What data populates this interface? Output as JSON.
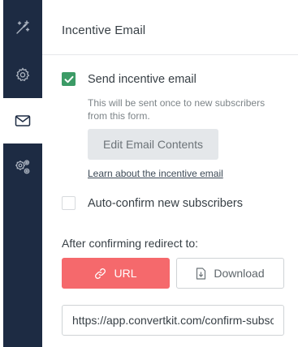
{
  "sidebar": {
    "items": [
      {
        "icon": "magic-wand-icon",
        "active": false
      },
      {
        "icon": "gear-icon",
        "active": false
      },
      {
        "icon": "envelope-icon",
        "active": true
      },
      {
        "icon": "gears-icon",
        "active": false
      }
    ],
    "rail_color": "#1d2b43"
  },
  "header": {
    "title": "Incentive Email"
  },
  "incentive": {
    "send_label": "Send incentive email",
    "send_checked": true,
    "help_text": "This will be sent once to new subscribers from this form.",
    "edit_button_label": "Edit Email Contents",
    "learn_link_label": "Learn about the incentive email"
  },
  "auto_confirm": {
    "label": "Auto-confirm new subscribers",
    "checked": false
  },
  "redirect": {
    "label": "After confirming redirect to:",
    "url_button_label": "URL",
    "download_button_label": "Download",
    "selected": "URL",
    "url_value": "https://app.convertkit.com/confirm-subscription"
  },
  "colors": {
    "accent_red": "#f5696c",
    "check_green": "#3c9b66"
  }
}
